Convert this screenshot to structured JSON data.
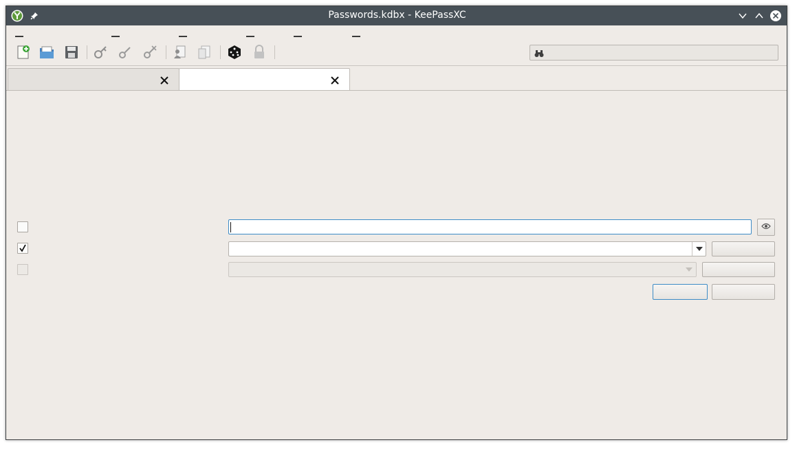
{
  "window": {
    "title": "Passwords.kdbx - KeePassXC"
  },
  "titlebar_icons": {
    "app": "keepassxc-logo-icon",
    "pin": "pin-icon",
    "minimize": "chevron-down-icon",
    "maximize": "chevron-up-icon",
    "close": "close-circle-icon"
  },
  "menubar": {
    "items": [
      "",
      "",
      "",
      "",
      "",
      ""
    ]
  },
  "toolbar": {
    "icons": [
      "new-database-icon",
      "open-database-icon",
      "save-database-icon",
      "new-entry-icon",
      "edit-entry-icon",
      "delete-entry-icon",
      "copy-username-icon",
      "copy-password-icon",
      "password-generator-icon",
      "lock-database-icon"
    ],
    "search": {
      "value": "",
      "placeholder": "",
      "icon": "search-binoculars-icon"
    }
  },
  "tabs": [
    {
      "label": "",
      "active": false
    },
    {
      "label": "",
      "active": true
    }
  ],
  "unlock_form": {
    "password": {
      "checked": false,
      "label": "",
      "value": ""
    },
    "keyfile": {
      "checked": true,
      "label": "",
      "value": "",
      "browse_label": ""
    },
    "challenge_response": {
      "checked": false,
      "label": "",
      "value": "",
      "refresh_label": ""
    },
    "ok_label": "",
    "cancel_label": ""
  },
  "colors": {
    "titlebar": "#475057",
    "window_bg": "#efebe7",
    "accent": "#3c8bc6"
  }
}
